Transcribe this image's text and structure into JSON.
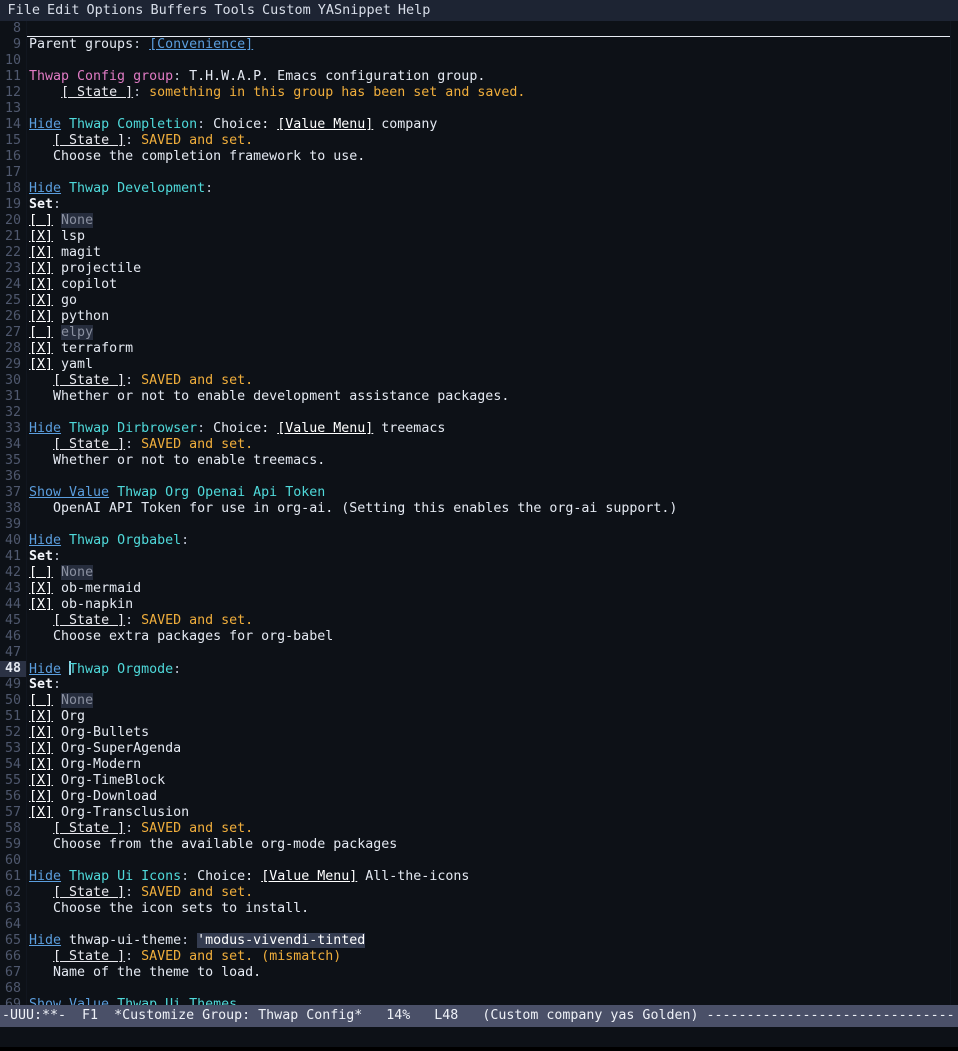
{
  "menubar": {
    "items": [
      {
        "label": "File"
      },
      {
        "label": "Edit"
      },
      {
        "label": "Options"
      },
      {
        "label": "Buffers"
      },
      {
        "label": "Tools"
      },
      {
        "label": "Custom"
      },
      {
        "label": "YASnippet"
      },
      {
        "label": "Help"
      }
    ]
  },
  "colors": {
    "background": "#0d1117",
    "menubar_bg": "#1d2433",
    "modeline_bg": "#4a5068",
    "link": "#5b9ede",
    "group_name": "#4fd9da",
    "main_group": "#e07bc4",
    "state_amber": "#f0ae3c",
    "foreground": "#e4e9f2",
    "linenum": "#4f586e",
    "field_bg": "#343c50",
    "off_bg": "#262d3d",
    "cursor": "#8fd6e8"
  },
  "buffer": {
    "first_line_number": 8,
    "current_line": 48,
    "lines": [
      {
        "n": 8,
        "rule": true,
        "parts": []
      },
      {
        "n": 9,
        "parts": [
          {
            "t": "Parent groups",
            "f": "plain"
          },
          {
            "t": ": ",
            "f": "punct"
          },
          {
            "t": "[Convenience]",
            "f": "link"
          }
        ]
      },
      {
        "n": 10,
        "parts": []
      },
      {
        "n": 11,
        "parts": [
          {
            "t": "Thwap Config group",
            "f": "maingroup"
          },
          {
            "t": ": ",
            "f": "punct"
          },
          {
            "t": "T.H.W.A.P. Emacs configuration group.",
            "f": "plain"
          }
        ]
      },
      {
        "n": 12,
        "parts": [
          {
            "t": "    ",
            "f": "plain"
          },
          {
            "t": "[ State ]",
            "f": "state"
          },
          {
            "t": ": ",
            "f": "punct"
          },
          {
            "t": "something in this group has been set and saved.",
            "f": "amber"
          }
        ]
      },
      {
        "n": 13,
        "parts": []
      },
      {
        "n": 14,
        "parts": [
          {
            "t": "Hide",
            "f": "link"
          },
          {
            "t": " ",
            "f": "plain"
          },
          {
            "t": "Thwap Completion",
            "f": "group"
          },
          {
            "t": ": ",
            "f": "punct"
          },
          {
            "t": "Choice: ",
            "f": "plain"
          },
          {
            "t": "[Value Menu]",
            "f": "btn"
          },
          {
            "t": " company",
            "f": "plain"
          }
        ]
      },
      {
        "n": 15,
        "parts": [
          {
            "t": "   ",
            "f": "plain"
          },
          {
            "t": "[ State ]",
            "f": "state"
          },
          {
            "t": ": ",
            "f": "punct"
          },
          {
            "t": "SAVED and set.",
            "f": "amber"
          }
        ]
      },
      {
        "n": 16,
        "parts": [
          {
            "t": "   Choose the completion framework to use.",
            "f": "plain"
          }
        ]
      },
      {
        "n": 17,
        "parts": []
      },
      {
        "n": 18,
        "parts": [
          {
            "t": "Hide",
            "f": "link"
          },
          {
            "t": " ",
            "f": "plain"
          },
          {
            "t": "Thwap Development",
            "f": "group"
          },
          {
            "t": ":",
            "f": "punct"
          }
        ]
      },
      {
        "n": 19,
        "parts": [
          {
            "t": "Set",
            "f": "bold"
          },
          {
            "t": ":",
            "f": "punct"
          }
        ]
      },
      {
        "n": 20,
        "parts": [
          {
            "t": "[ ]",
            "f": "box"
          },
          {
            "t": " ",
            "f": "plain"
          },
          {
            "t": "None",
            "f": "off"
          }
        ]
      },
      {
        "n": 21,
        "parts": [
          {
            "t": "[X]",
            "f": "box"
          },
          {
            "t": " lsp",
            "f": "plain"
          }
        ]
      },
      {
        "n": 22,
        "parts": [
          {
            "t": "[X]",
            "f": "box"
          },
          {
            "t": " magit",
            "f": "plain"
          }
        ]
      },
      {
        "n": 23,
        "parts": [
          {
            "t": "[X]",
            "f": "box"
          },
          {
            "t": " projectile",
            "f": "plain"
          }
        ]
      },
      {
        "n": 24,
        "parts": [
          {
            "t": "[X]",
            "f": "box"
          },
          {
            "t": " copilot",
            "f": "plain"
          }
        ]
      },
      {
        "n": 25,
        "parts": [
          {
            "t": "[X]",
            "f": "box"
          },
          {
            "t": " go",
            "f": "plain"
          }
        ]
      },
      {
        "n": 26,
        "parts": [
          {
            "t": "[X]",
            "f": "box"
          },
          {
            "t": " python",
            "f": "plain"
          }
        ]
      },
      {
        "n": 27,
        "parts": [
          {
            "t": "[ ]",
            "f": "box"
          },
          {
            "t": " ",
            "f": "plain"
          },
          {
            "t": "elpy",
            "f": "off"
          }
        ]
      },
      {
        "n": 28,
        "parts": [
          {
            "t": "[X]",
            "f": "box"
          },
          {
            "t": " terraform",
            "f": "plain"
          }
        ]
      },
      {
        "n": 29,
        "parts": [
          {
            "t": "[X]",
            "f": "box"
          },
          {
            "t": " yaml",
            "f": "plain"
          }
        ]
      },
      {
        "n": 30,
        "parts": [
          {
            "t": "   ",
            "f": "plain"
          },
          {
            "t": "[ State ]",
            "f": "state"
          },
          {
            "t": ": ",
            "f": "punct"
          },
          {
            "t": "SAVED and set.",
            "f": "amber"
          }
        ]
      },
      {
        "n": 31,
        "parts": [
          {
            "t": "   Whether or not to enable development assistance packages.",
            "f": "plain"
          }
        ]
      },
      {
        "n": 32,
        "parts": []
      },
      {
        "n": 33,
        "parts": [
          {
            "t": "Hide",
            "f": "link"
          },
          {
            "t": " ",
            "f": "plain"
          },
          {
            "t": "Thwap Dirbrowser",
            "f": "group"
          },
          {
            "t": ": ",
            "f": "punct"
          },
          {
            "t": "Choice: ",
            "f": "plain"
          },
          {
            "t": "[Value Menu]",
            "f": "btn"
          },
          {
            "t": " treemacs",
            "f": "plain"
          }
        ]
      },
      {
        "n": 34,
        "parts": [
          {
            "t": "   ",
            "f": "plain"
          },
          {
            "t": "[ State ]",
            "f": "state"
          },
          {
            "t": ": ",
            "f": "punct"
          },
          {
            "t": "SAVED and set.",
            "f": "amber"
          }
        ]
      },
      {
        "n": 35,
        "parts": [
          {
            "t": "   Whether or not to enable treemacs.",
            "f": "plain"
          }
        ]
      },
      {
        "n": 36,
        "parts": []
      },
      {
        "n": 37,
        "parts": [
          {
            "t": "Show Value",
            "f": "link"
          },
          {
            "t": " ",
            "f": "plain"
          },
          {
            "t": "Thwap Org Openai Api Token",
            "f": "group"
          }
        ]
      },
      {
        "n": 38,
        "parts": [
          {
            "t": "   OpenAI API Token for use in org-ai. (Setting this enables the org-ai support.)",
            "f": "plain"
          }
        ]
      },
      {
        "n": 39,
        "parts": []
      },
      {
        "n": 40,
        "parts": [
          {
            "t": "Hide",
            "f": "link"
          },
          {
            "t": " ",
            "f": "plain"
          },
          {
            "t": "Thwap Orgbabel",
            "f": "group"
          },
          {
            "t": ":",
            "f": "punct"
          }
        ]
      },
      {
        "n": 41,
        "parts": [
          {
            "t": "Set",
            "f": "bold"
          },
          {
            "t": ":",
            "f": "punct"
          }
        ]
      },
      {
        "n": 42,
        "parts": [
          {
            "t": "[ ]",
            "f": "box"
          },
          {
            "t": " ",
            "f": "plain"
          },
          {
            "t": "None",
            "f": "off"
          }
        ]
      },
      {
        "n": 43,
        "parts": [
          {
            "t": "[X]",
            "f": "box"
          },
          {
            "t": " ob-mermaid",
            "f": "plain"
          }
        ]
      },
      {
        "n": 44,
        "parts": [
          {
            "t": "[X]",
            "f": "box"
          },
          {
            "t": " ob-napkin",
            "f": "plain"
          }
        ]
      },
      {
        "n": 45,
        "parts": [
          {
            "t": "   ",
            "f": "plain"
          },
          {
            "t": "[ State ]",
            "f": "state"
          },
          {
            "t": ": ",
            "f": "punct"
          },
          {
            "t": "SAVED and set.",
            "f": "amber"
          }
        ]
      },
      {
        "n": 46,
        "parts": [
          {
            "t": "   Choose extra packages for org-babel",
            "f": "plain"
          }
        ]
      },
      {
        "n": 47,
        "parts": []
      },
      {
        "n": 48,
        "current": true,
        "parts": [
          {
            "t": "Hide",
            "f": "link"
          },
          {
            "t": " ",
            "f": "plain"
          },
          {
            "t": "",
            "f": "cursor"
          },
          {
            "t": "Thwap Orgmode",
            "f": "group"
          },
          {
            "t": ":",
            "f": "punct"
          }
        ]
      },
      {
        "n": 49,
        "parts": [
          {
            "t": "Set",
            "f": "bold"
          },
          {
            "t": ":",
            "f": "punct"
          }
        ]
      },
      {
        "n": 50,
        "parts": [
          {
            "t": "[ ]",
            "f": "box"
          },
          {
            "t": " ",
            "f": "plain"
          },
          {
            "t": "None",
            "f": "off"
          }
        ]
      },
      {
        "n": 51,
        "parts": [
          {
            "t": "[X]",
            "f": "box"
          },
          {
            "t": " Org",
            "f": "plain"
          }
        ]
      },
      {
        "n": 52,
        "parts": [
          {
            "t": "[X]",
            "f": "box"
          },
          {
            "t": " Org-Bullets",
            "f": "plain"
          }
        ]
      },
      {
        "n": 53,
        "parts": [
          {
            "t": "[X]",
            "f": "box"
          },
          {
            "t": " Org-SuperAgenda",
            "f": "plain"
          }
        ]
      },
      {
        "n": 54,
        "parts": [
          {
            "t": "[X]",
            "f": "box"
          },
          {
            "t": " Org-Modern",
            "f": "plain"
          }
        ]
      },
      {
        "n": 55,
        "parts": [
          {
            "t": "[X]",
            "f": "box"
          },
          {
            "t": " Org-TimeBlock",
            "f": "plain"
          }
        ]
      },
      {
        "n": 56,
        "parts": [
          {
            "t": "[X]",
            "f": "box"
          },
          {
            "t": " Org-Download",
            "f": "plain"
          }
        ]
      },
      {
        "n": 57,
        "parts": [
          {
            "t": "[X]",
            "f": "box"
          },
          {
            "t": " Org-Transclusion",
            "f": "plain"
          }
        ]
      },
      {
        "n": 58,
        "parts": [
          {
            "t": "   ",
            "f": "plain"
          },
          {
            "t": "[ State ]",
            "f": "state"
          },
          {
            "t": ": ",
            "f": "punct"
          },
          {
            "t": "SAVED and set.",
            "f": "amber"
          }
        ]
      },
      {
        "n": 59,
        "parts": [
          {
            "t": "   Choose from the available org-mode packages",
            "f": "plain"
          }
        ]
      },
      {
        "n": 60,
        "parts": []
      },
      {
        "n": 61,
        "parts": [
          {
            "t": "Hide",
            "f": "link"
          },
          {
            "t": " ",
            "f": "plain"
          },
          {
            "t": "Thwap Ui Icons",
            "f": "group"
          },
          {
            "t": ": ",
            "f": "punct"
          },
          {
            "t": "Choice: ",
            "f": "plain"
          },
          {
            "t": "[Value Menu]",
            "f": "btn"
          },
          {
            "t": " All-the-icons",
            "f": "plain"
          }
        ]
      },
      {
        "n": 62,
        "parts": [
          {
            "t": "   ",
            "f": "plain"
          },
          {
            "t": "[ State ]",
            "f": "state"
          },
          {
            "t": ": ",
            "f": "punct"
          },
          {
            "t": "SAVED and set.",
            "f": "amber"
          }
        ]
      },
      {
        "n": 63,
        "parts": [
          {
            "t": "   Choose the icon sets to install.",
            "f": "plain"
          }
        ]
      },
      {
        "n": 64,
        "parts": []
      },
      {
        "n": 65,
        "parts": [
          {
            "t": "Hide",
            "f": "link"
          },
          {
            "t": " ",
            "f": "plain"
          },
          {
            "t": "thwap-ui-theme",
            "f": "plain"
          },
          {
            "t": ": ",
            "f": "punct"
          },
          {
            "t": "'modus-vivendi-tinted",
            "f": "field"
          }
        ]
      },
      {
        "n": 66,
        "parts": [
          {
            "t": "   ",
            "f": "plain"
          },
          {
            "t": "[ State ]",
            "f": "state"
          },
          {
            "t": ": ",
            "f": "punct"
          },
          {
            "t": "SAVED and set. (mismatch)",
            "f": "amber"
          }
        ]
      },
      {
        "n": 67,
        "parts": [
          {
            "t": "   Name of the theme to load.",
            "f": "plain"
          }
        ]
      },
      {
        "n": 68,
        "parts": []
      },
      {
        "n": 69,
        "parts": [
          {
            "t": "Show Value",
            "f": "link"
          },
          {
            "t": " ",
            "f": "plain"
          },
          {
            "t": "Thwap Ui Themes",
            "f": "group"
          }
        ]
      }
    ]
  },
  "modeline": {
    "text": "-UUU:**-  F1  *Customize Group: Thwap Config*   14%   L48   (Custom company yas Golden) ",
    "encoding": "-UUU:**-",
    "frame": "F1",
    "buffer_name": "*Customize Group: Thwap Config*",
    "percent": "14%",
    "line": "L48",
    "modes": "(Custom company yas Golden)",
    "filler": "-"
  }
}
